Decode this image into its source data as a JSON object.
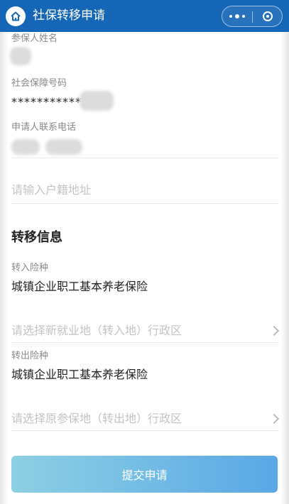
{
  "navbar": {
    "title": "社保转移申请"
  },
  "form": {
    "name": {
      "label": "参保人姓名",
      "value": ""
    },
    "ssn": {
      "label": "社会保障号码",
      "value": "**************"
    },
    "phone": {
      "label": "申请人联系电话",
      "value": ""
    },
    "household_address": {
      "placeholder": "请输入户籍地址"
    }
  },
  "transfer": {
    "title": "转移信息",
    "in_insurance": {
      "label": "转入险种",
      "value": "城镇企业职工基本养老保险"
    },
    "new_region": {
      "placeholder": "请选择新就业地（转入地）行政区"
    },
    "out_insurance": {
      "label": "转出险种",
      "value": "城镇企业职工基本养老保险"
    },
    "old_region": {
      "placeholder": "请选择原参保地（转出地）行政区"
    }
  },
  "submit_label": "提交申请",
  "colors": {
    "navbar": "#1666b8",
    "button_start": "#8dd0e3",
    "button_end": "#5aa8e6"
  }
}
